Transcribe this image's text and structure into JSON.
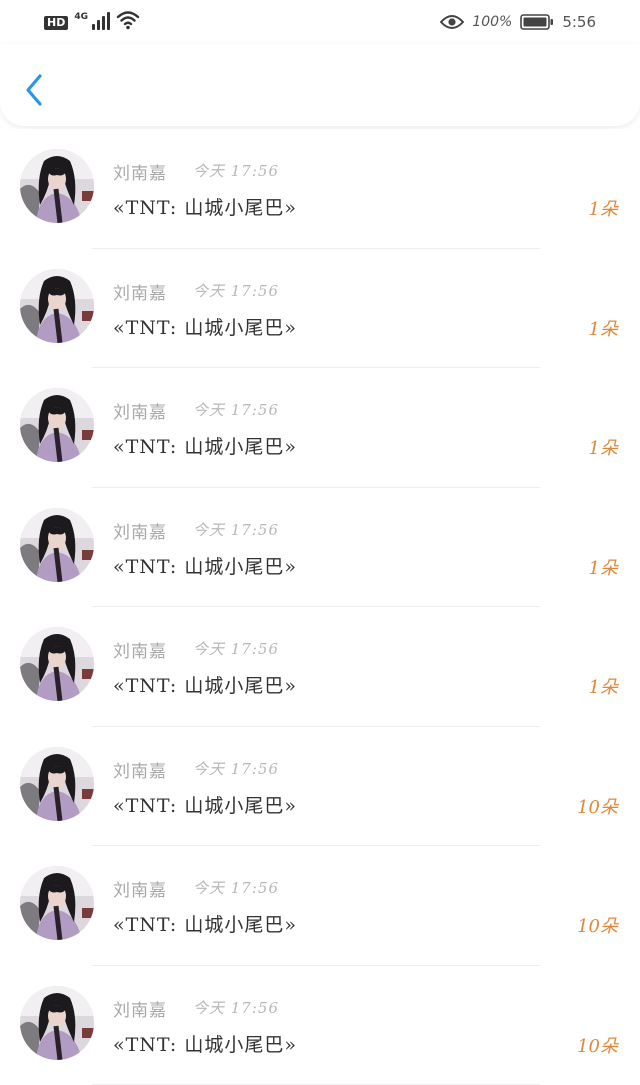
{
  "status_bar": {
    "hd": "HD",
    "network": "4G",
    "battery_percent": "100%",
    "time": "5:56",
    "icons": [
      "hd-badge",
      "signal-icon",
      "wifi-icon",
      "eye-icon",
      "battery-icon"
    ]
  },
  "header": {
    "back_icon": "chevron-left-icon",
    "accent_color": "#2a96e6"
  },
  "rows": [
    {
      "name": "刘南嘉",
      "time": "今天 17:56",
      "title": "«TNT: 山城小尾巴»",
      "count": "1朵"
    },
    {
      "name": "刘南嘉",
      "time": "今天 17:56",
      "title": "«TNT: 山城小尾巴»",
      "count": "1朵"
    },
    {
      "name": "刘南嘉",
      "time": "今天 17:56",
      "title": "«TNT: 山城小尾巴»",
      "count": "1朵"
    },
    {
      "name": "刘南嘉",
      "time": "今天 17:56",
      "title": "«TNT: 山城小尾巴»",
      "count": "1朵"
    },
    {
      "name": "刘南嘉",
      "time": "今天 17:56",
      "title": "«TNT: 山城小尾巴»",
      "count": "1朵"
    },
    {
      "name": "刘南嘉",
      "time": "今天 17:56",
      "title": "«TNT: 山城小尾巴»",
      "count": "10朵"
    },
    {
      "name": "刘南嘉",
      "time": "今天 17:56",
      "title": "«TNT: 山城小尾巴»",
      "count": "10朵"
    },
    {
      "name": "刘南嘉",
      "time": "今天 17:56",
      "title": "«TNT: 山城小尾巴»",
      "count": "10朵"
    }
  ],
  "colors": {
    "count_color": "#e0883a",
    "name_color": "#a8a8a8",
    "title_color": "#333333"
  }
}
